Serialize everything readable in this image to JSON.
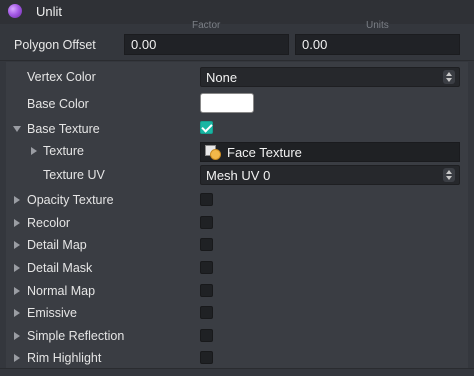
{
  "header": {
    "title": "Unlit"
  },
  "polygon_offset": {
    "label": "Polygon Offset",
    "factor_label": "Factor",
    "units_label": "Units",
    "factor_value": "0.00",
    "units_value": "0.00"
  },
  "rows": {
    "vertex_color": {
      "label": "Vertex Color",
      "value": "None"
    },
    "base_color": {
      "label": "Base Color",
      "swatch_color": "#ffffff"
    },
    "base_texture": {
      "label": "Base Texture",
      "checked": true
    },
    "texture": {
      "label": "Texture",
      "value": "Face Texture"
    },
    "texture_uv": {
      "label": "Texture UV",
      "value": "Mesh UV 0"
    },
    "opacity_texture": {
      "label": "Opacity Texture"
    },
    "recolor": {
      "label": "Recolor"
    },
    "detail_map": {
      "label": "Detail Map"
    },
    "detail_mask": {
      "label": "Detail Mask"
    },
    "normal_map": {
      "label": "Normal Map"
    },
    "emissive": {
      "label": "Emissive"
    },
    "simple_reflection": {
      "label": "Simple Reflection"
    },
    "rim_highlight": {
      "label": "Rim Highlight"
    }
  },
  "colors": {
    "accent_check": "#18b6a3",
    "header_icon": "#a55be6"
  }
}
